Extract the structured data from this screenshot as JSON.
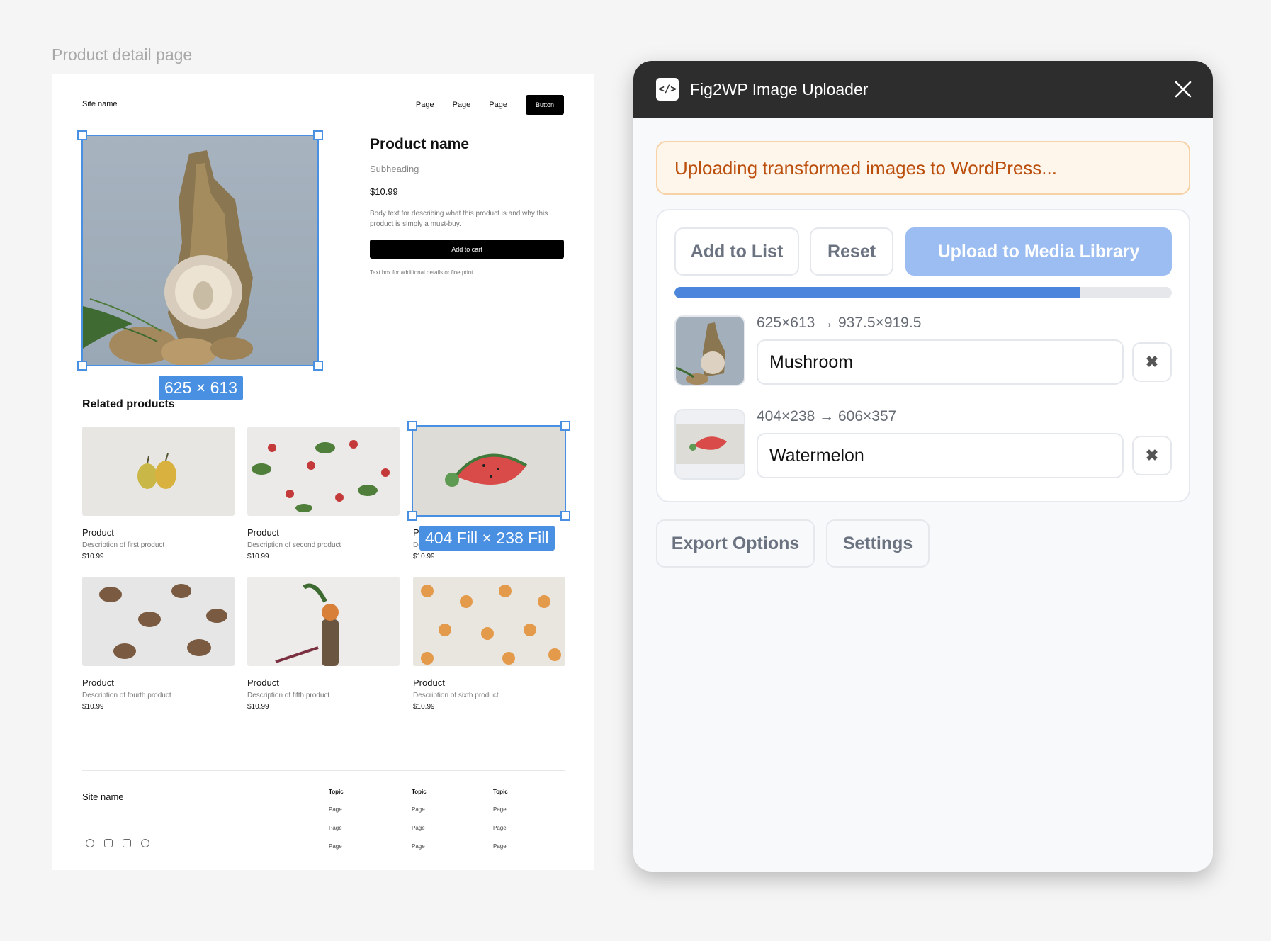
{
  "canvas": {
    "frame_label": "Product detail page",
    "nav": {
      "site_name": "Site name",
      "links": [
        "Page",
        "Page",
        "Page"
      ],
      "button": "Button"
    },
    "product": {
      "title": "Product name",
      "subheading": "Subheading",
      "price": "$10.99",
      "body": "Body text for describing what this product is and why this product is simply a must-buy.",
      "cart_button": "Add to cart",
      "fine_print": "Text box for additional details or fine print"
    },
    "hero_dim_badge": "625 × 613",
    "card_dim_badge": "404 Fill × 238 Fill",
    "related_title": "Related products",
    "products": [
      {
        "name": "Product",
        "desc": "Description of first product",
        "price": "$10.99"
      },
      {
        "name": "Product",
        "desc": "Description of second product",
        "price": "$10.99"
      },
      {
        "name": "Pr",
        "desc": "De",
        "price": "$10.99"
      },
      {
        "name": "Product",
        "desc": "Description of fourth product",
        "price": "$10.99"
      },
      {
        "name": "Product",
        "desc": "Description of fifth product",
        "price": "$10.99"
      },
      {
        "name": "Product",
        "desc": "Description of sixth product",
        "price": "$10.99"
      }
    ],
    "footer": {
      "site_name": "Site name",
      "columns": [
        {
          "topic": "Topic",
          "pages": [
            "Page",
            "Page",
            "Page"
          ]
        },
        {
          "topic": "Topic",
          "pages": [
            "Page",
            "Page",
            "Page"
          ]
        },
        {
          "topic": "Topic",
          "pages": [
            "Page",
            "Page",
            "Page"
          ]
        }
      ],
      "social_icons": [
        "facebook-icon",
        "linkedin-icon",
        "youtube-icon",
        "instagram-icon"
      ]
    }
  },
  "panel": {
    "logo_glyph": "</>",
    "title": "Fig2WP Image Uploader",
    "status": "Uploading transformed images to WordPress...",
    "buttons": {
      "add": "Add to List",
      "reset": "Reset",
      "upload": "Upload to Media Library"
    },
    "progress_fraction": 0.815,
    "items": [
      {
        "dims": "625×613 → 937.5×919.5",
        "name": "Mushroom"
      },
      {
        "dims": "404×238 → 606×357",
        "name": "Watermelon"
      }
    ],
    "remove_glyph": "✖",
    "export_options": "Export Options",
    "settings": "Settings"
  },
  "colors": {
    "accent": "#4a90e2",
    "primary_button": "#9bbdf1",
    "progress": "#4b85dc",
    "status_text": "#bb4f0e",
    "status_bg": "#fff6eb"
  }
}
